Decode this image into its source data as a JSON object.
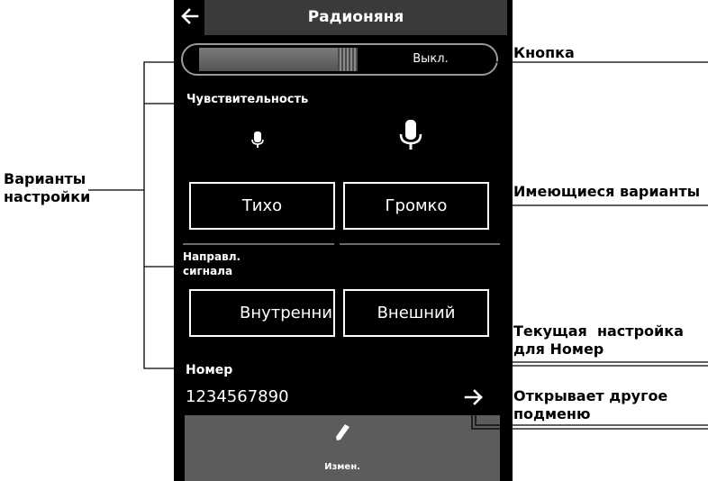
{
  "header": {
    "title": "Радионяня",
    "back_icon": "arrow-left-icon"
  },
  "toggle": {
    "state_label": "Выкл."
  },
  "sensitivity": {
    "label": "Чувствительность",
    "options": [
      {
        "label": "Тихо",
        "icon": "microphone-small-icon"
      },
      {
        "label": "Громко",
        "icon": "microphone-large-icon"
      }
    ]
  },
  "direction": {
    "label_line1": "Направл.",
    "label_line2": "сигнала",
    "options": [
      {
        "label": "Внутренни"
      },
      {
        "label": "Внешний"
      }
    ]
  },
  "number": {
    "label": "Номер",
    "value": "1234567890",
    "arrow_icon": "arrow-right-icon"
  },
  "bottom_bar": {
    "edit_label": "Измен.",
    "icon": "pencil-icon"
  },
  "annotations": {
    "button": "Кнопка",
    "variants_line1": "Варианты",
    "variants_line2": "настройки",
    "options": "Имеющиеся варианты",
    "current_line1": "Текущая  настройка",
    "current_line2": "для Номер",
    "submenu_line1": "Открывает другое",
    "submenu_line2": "подменю"
  },
  "colors": {
    "screen_bg": "#000000",
    "header_bg": "#3a3a3a",
    "bottom_bar_bg": "#5c5c5c",
    "text": "#ffffff"
  }
}
